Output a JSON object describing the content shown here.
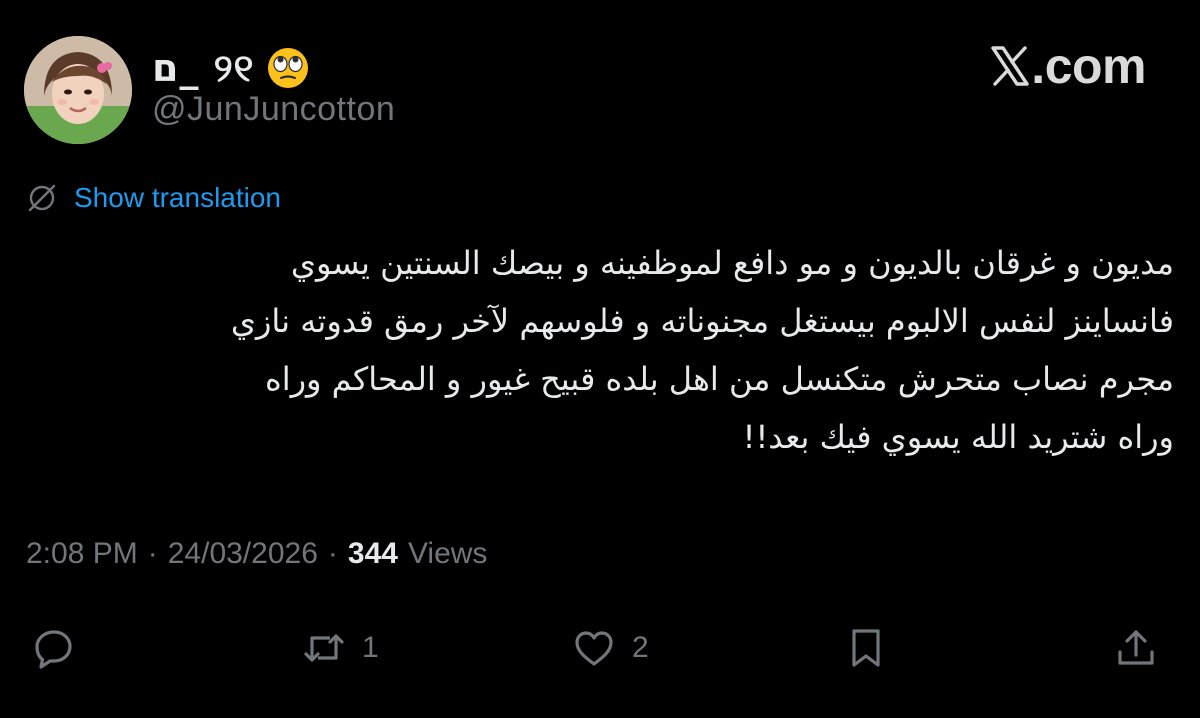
{
  "author": {
    "display_name": "ם_ ୨୧",
    "handle": "@JunJuncotton",
    "emoji_icon": "face-rolling-eyes-icon"
  },
  "brand": {
    "text": ".com"
  },
  "translation": {
    "label": "Show translation"
  },
  "tweet": {
    "lines": [
      "مديون و غرقان بالديون و مو دافع لموظفينه و بيصك السنتين يسوي",
      "فانساينز لنفس الالبوم بيستغل مجنوناته و فلوسهم لآخر رمق قدوته نازي",
      "مجرم نصاب متحرش متكنسل من اهل بلده قبيح غيور و المحاكم وراه",
      "وراه شتريد الله يسوي فيك بعد!!"
    ]
  },
  "meta": {
    "time": "2:08 PM",
    "separator": "·",
    "date": "24/03/2026",
    "views_count": "344",
    "views_label": "Views"
  },
  "actions": {
    "reply_count": "",
    "retweet_count": "1",
    "like_count": "2"
  },
  "colors": {
    "background": "#000000",
    "text": "#e7e9ea",
    "muted": "#71767b",
    "link": "#1d9bf0"
  }
}
